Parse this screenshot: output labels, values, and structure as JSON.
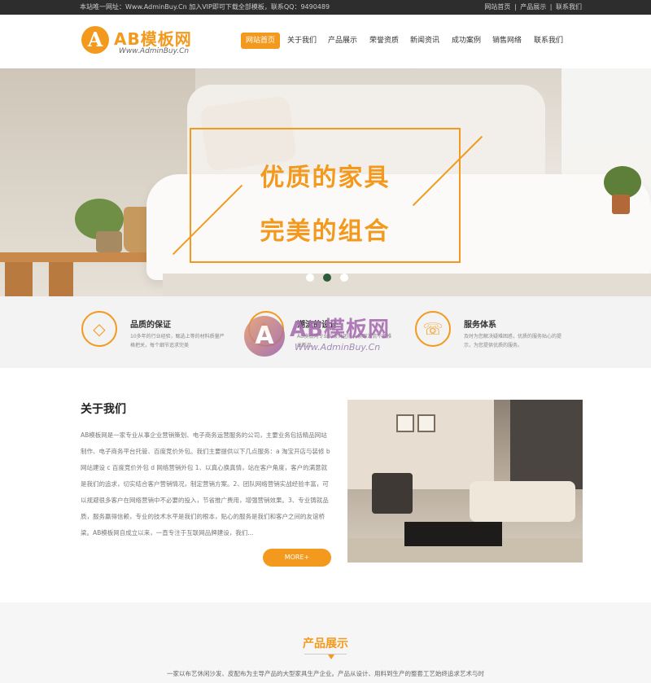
{
  "topbar": {
    "notice": "本站唯一网址：Www.AdminBuy.Cn 加入VIP即可下载全部模板，联系QQ：9490489",
    "links": [
      "网站首页",
      "产品展示",
      "联系我们"
    ],
    "sep": "|"
  },
  "logo": {
    "mark": "A",
    "brand": "AB模板网",
    "site": "Www.AdminBuy.Cn"
  },
  "nav": {
    "items": [
      "网站首页",
      "关于我们",
      "产品展示",
      "荣誉资质",
      "新闻资讯",
      "成功案例",
      "销售网络",
      "联系我们"
    ],
    "active_index": 0
  },
  "banner": {
    "line1": "优质的家具",
    "line2": "完美的组合",
    "slides": 3,
    "active_slide": 1
  },
  "features": [
    {
      "icon": "diamond-icon",
      "glyph": "◇",
      "title": "品质的保证",
      "desc": "10多年的行业经验，甄选上等的材料质量严格把关，每个细节追求完美"
    },
    {
      "icon": "design-icon",
      "glyph": "✎",
      "title": "潮流的设计",
      "desc": "AB模板网专业的设计团队，紧跟潮流不断推出新品"
    },
    {
      "icon": "headset-icon",
      "glyph": "☏",
      "title": "服务体系",
      "desc": "及时为您解决疑难困惑，优质的服务贴心的提示，为您提供优质的服务。"
    }
  ],
  "watermark": {
    "mark": "A",
    "text": "AB模板网",
    "site": "Www.AdminBuy.Cn"
  },
  "about": {
    "title": "关于我们",
    "text": "AB模板网是一家专业从事企业营销策划、电子商务运营服务的公司，主要业务包括精品网站制作、电子商务平台托管、百度竞价外包。我们主要提供以下几点服务：a 淘宝开店与装修 b 网站建设 c 百度竞价外包 d 网络营销外包 1、以真心换真情，站在客户角度，客户的满意就是我们的追求，切实结合客户营销情况，制定营销方案。2、团队网络营销实战经验丰富，可以规避很多客户在网络营销中不必要的投入，节省推广费用，增强营销效果。3、专业铸就品质，服务赢得信赖，专业的技术水平是我们的根本，贴心的服务是我们和客户之间的友谊桥梁。AB模板网自成立以来，一直专注于互联网品牌建设，我们...",
    "more": "MORE+"
  },
  "products": {
    "title": "产品展示",
    "desc": "一家以布艺休闲沙发、皮配布为主导产品的大型家具生产企业。产品从设计、用料到生产的整套工艺始终追求艺术与时"
  },
  "colors": {
    "accent": "#f39a1e",
    "topbar": "#2d2d2d",
    "dot_active": "#2c5c3a"
  }
}
